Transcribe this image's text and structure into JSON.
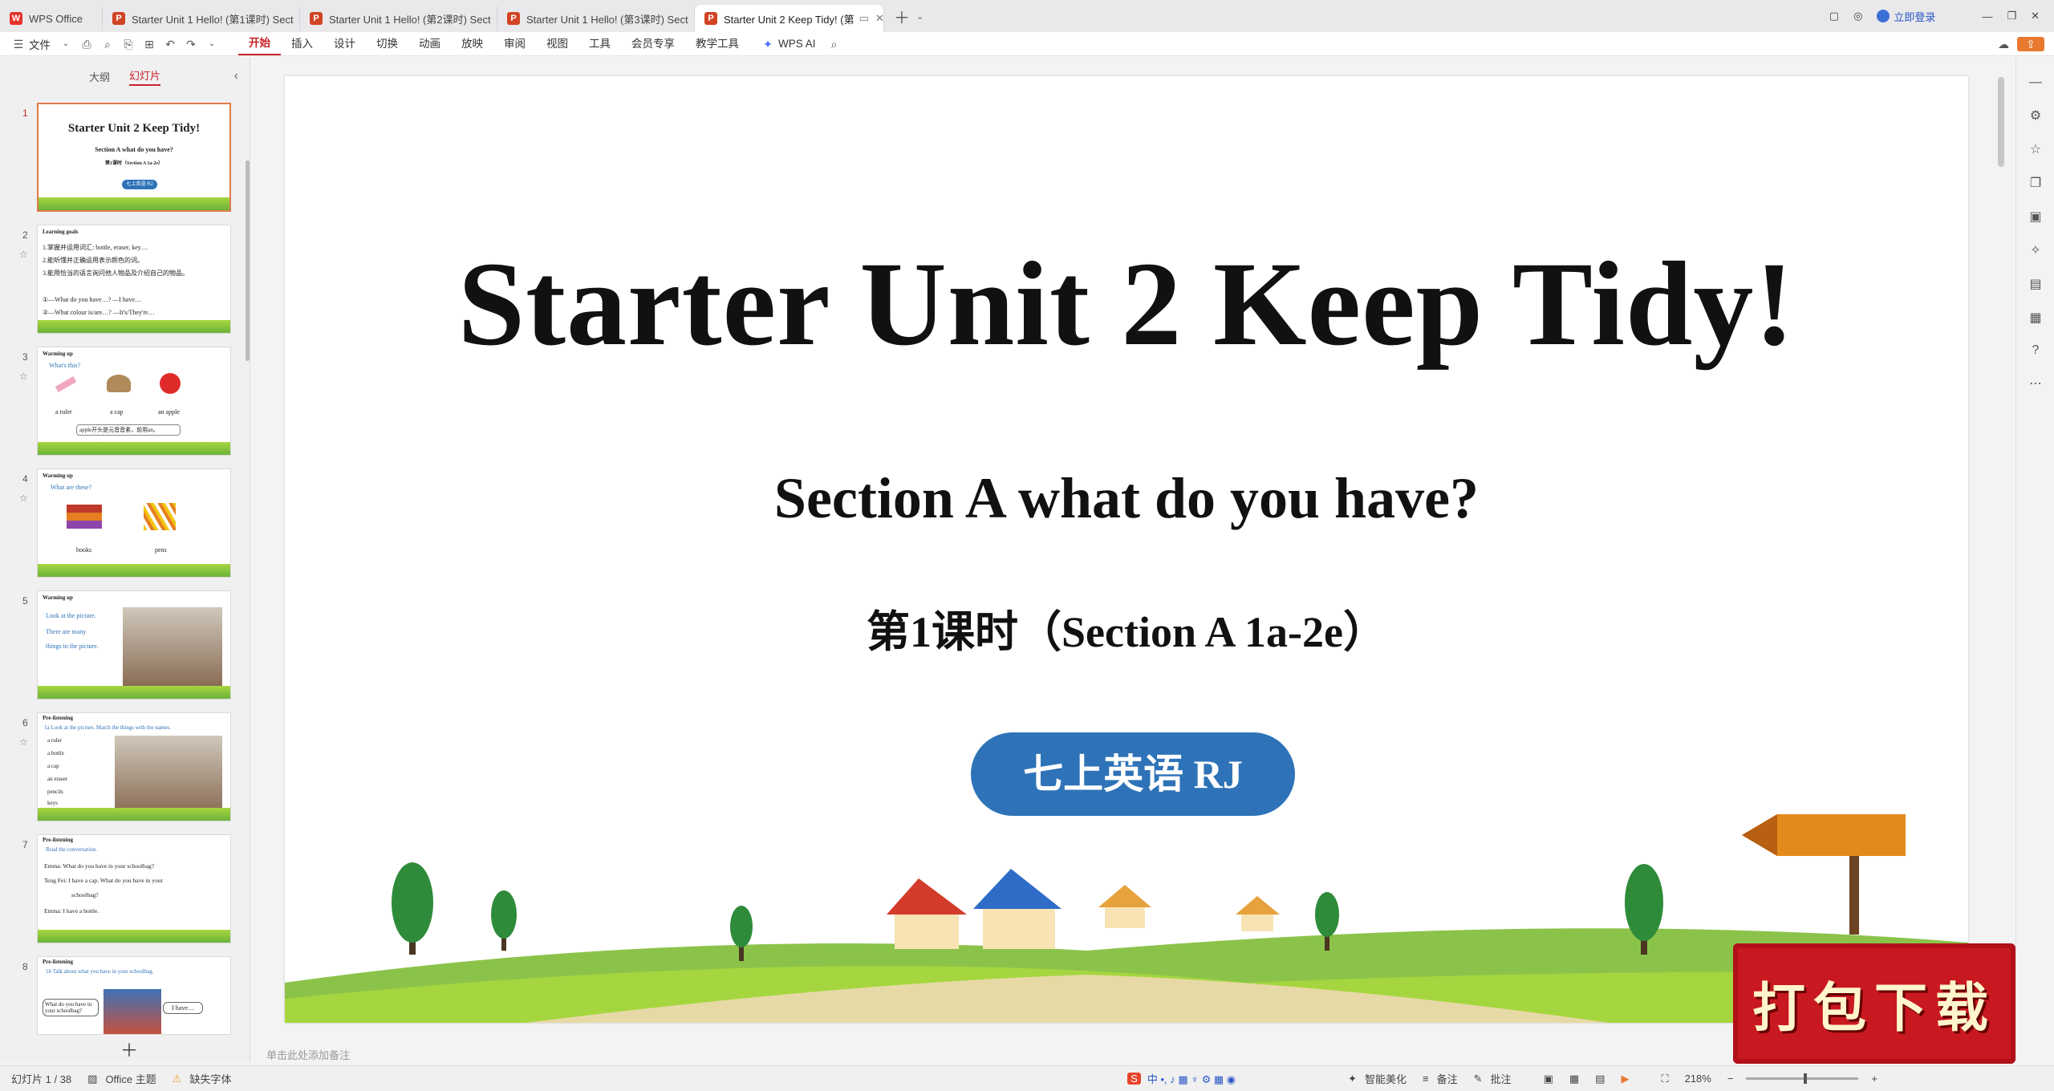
{
  "tabs": [
    {
      "label": "WPS Office",
      "active": false,
      "icon": "wps-logo"
    },
    {
      "label": "Starter Unit 1 Hello! (第1课时) Sect",
      "active": false,
      "icon": "ppt-icon"
    },
    {
      "label": "Starter Unit 1 Hello! (第2课时) Sect",
      "active": false,
      "icon": "ppt-icon"
    },
    {
      "label": "Starter Unit 1 Hello! (第3课时) Sect",
      "active": false,
      "icon": "ppt-icon"
    },
    {
      "label": "Starter Unit 2 Keep Tidy! (第",
      "active": true,
      "icon": "ppt-icon"
    }
  ],
  "titlebar": {
    "login": "立即登录"
  },
  "menu": {
    "file": "文件",
    "items": [
      "开始",
      "插入",
      "设计",
      "切换",
      "动画",
      "放映",
      "审阅",
      "视图",
      "工具",
      "会员专享",
      "教学工具"
    ],
    "wps_ai": "WPS AI"
  },
  "sidebar": {
    "tab_outline": "大纲",
    "tab_slides": "幻灯片",
    "slides": [
      {
        "num": "1",
        "lines": [
          "Starter Unit 2 Keep Tidy!",
          "Section A  what do you have?",
          "第1课时（Section A 1a-2e）",
          "七上英语 RJ"
        ]
      },
      {
        "num": "2",
        "lines": [
          "Learning goals",
          "1.掌握并运用词汇: bottle, eraser, key…",
          "2.能听懂并正确运用表示颜色的词。",
          "3.能用恰当的语言询问他人物品及介绍自己的物品。",
          "①—What do you have…? —I have…",
          "②—What colour is/are…? —It's/They're…"
        ]
      },
      {
        "num": "3",
        "lines": [
          "Warming up",
          "What's this?",
          "a ruler",
          "a cap",
          "an apple",
          "apple开头是元音音素，前用an。"
        ]
      },
      {
        "num": "4",
        "lines": [
          "Warming up",
          "What are these?",
          "books",
          "pens"
        ]
      },
      {
        "num": "5",
        "lines": [
          "Warming up",
          "Look at the picture.",
          "There are many",
          "things in the picture."
        ]
      },
      {
        "num": "6",
        "lines": [
          "Pre-listening",
          "1a Look at the picture. Match the things with the names.",
          "a ruler",
          "a bottle",
          "a cap",
          "an eraser",
          "pencils",
          "keys"
        ]
      },
      {
        "num": "7",
        "lines": [
          "Pre-listening",
          "Read the conversation.",
          "Emma: What do you have in your schoolbag?",
          "Teng Fei: I have a cap. What do you have in your",
          "schoolbag?",
          "Emma: I have a bottle."
        ]
      },
      {
        "num": "8",
        "lines": [
          "Pre-listening",
          "1b Talk about what you have in your schoolbag.",
          "What do you have in your schoolbag?",
          "I have…"
        ]
      }
    ]
  },
  "slide": {
    "title": "Starter Unit 2 Keep Tidy!",
    "subtitle": "Section A  what do you have?",
    "lesson": "第1课时（Section A 1a-2e）",
    "badge": "七上英语 RJ"
  },
  "notes_placeholder": "单击此处添加备注",
  "status": {
    "slide_counter": "幻灯片 1 / 38",
    "theme": "Office 主题",
    "missing_fonts": "缺失字体",
    "beautify": "智能美化",
    "notes": "备注",
    "comments": "批注",
    "zoom": "218%"
  },
  "stamp_text": "打包下载",
  "colors": {
    "accent": "#c8222b",
    "badge": "#2e73b8",
    "stamp": "#c81820"
  }
}
